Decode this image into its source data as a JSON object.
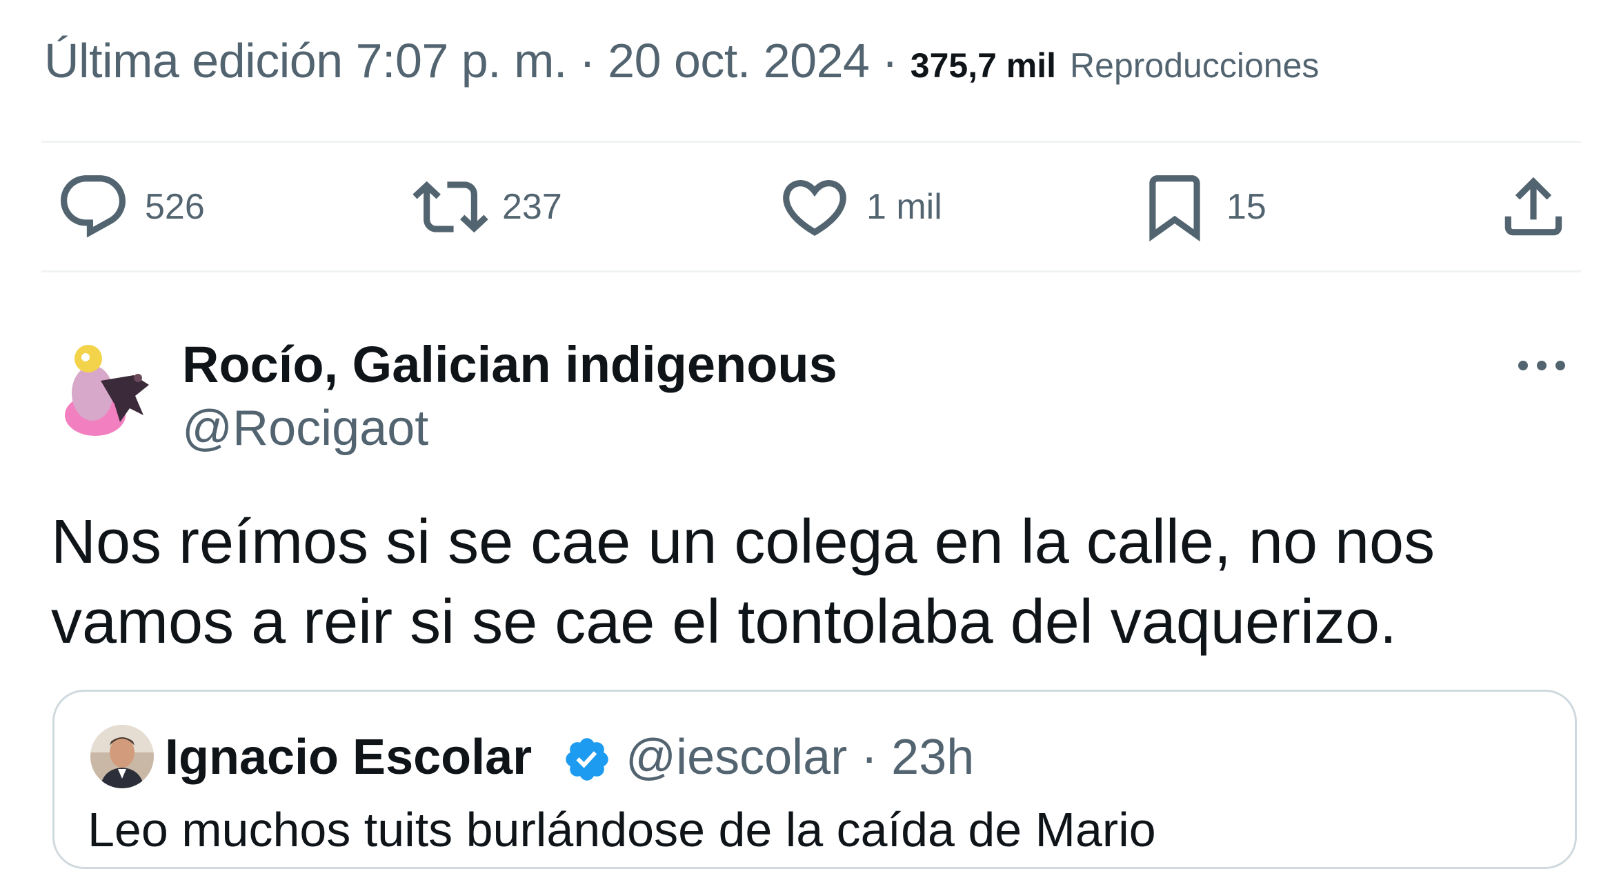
{
  "meta": {
    "edited": "Última edición 7:07 p. m.",
    "sep1": "·",
    "date": "20 oct. 2024",
    "sep2": "·",
    "views_count": "375,7 mil",
    "views_label": "Reproducciones"
  },
  "actions": {
    "replies": "526",
    "retweets": "237",
    "likes": "1 mil",
    "bookmarks": "15"
  },
  "reply": {
    "display_name": "Rocío, Galician indigenous",
    "handle": "@Rocigaot",
    "text_line1": "Nos reímos si se cae un colega en la calle, no nos",
    "text_line2": "vamos a reir si se cae el tontolaba del vaquerizo."
  },
  "quote": {
    "display_name": "Ignacio Escolar",
    "handle_time": "@iescolar · 23h",
    "text": "Leo muchos tuits burlándose de la caída de Mario"
  },
  "colors": {
    "text_primary": "#0f1419",
    "text_secondary": "#536471",
    "divider": "#eff3f4",
    "verified": "#1d9bf0"
  }
}
